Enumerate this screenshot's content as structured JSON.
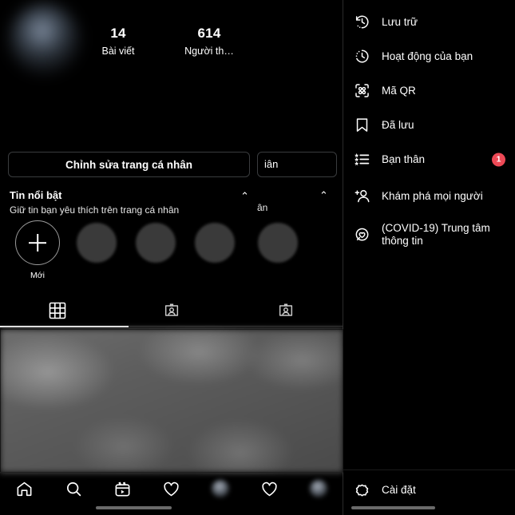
{
  "profile": {
    "stats": [
      {
        "number": "14",
        "label": "Bài viết"
      },
      {
        "number": "614",
        "label": "Người th…"
      }
    ],
    "edit_button_label": "Chỉnh sửa trang cá nhân",
    "highlights": {
      "title": "Tin nổi bật",
      "subtitle": "Giữ tin bạn yêu thích trên trang cá nhân",
      "new_label": "Mới",
      "collapse_chevron": "⌃"
    },
    "ghost_layer": {
      "button_fragment": "iân",
      "subtitle_fragment": "ân",
      "chevron": "⌃"
    },
    "tabs": [
      {
        "name": "grid-tab",
        "icon": "grid-icon",
        "active": true
      },
      {
        "name": "tagged-tab",
        "icon": "portrait-icon",
        "active": false
      },
      {
        "name": "tagged-tab-2",
        "icon": "portrait-icon",
        "active": false
      }
    ],
    "bottom_nav": [
      {
        "name": "home",
        "icon": "home-icon"
      },
      {
        "name": "search",
        "icon": "search-icon"
      },
      {
        "name": "reels",
        "icon": "reels-icon"
      },
      {
        "name": "activity",
        "icon": "heart-icon"
      },
      {
        "name": "profile",
        "icon": "avatar-icon"
      },
      {
        "name": "activity-2",
        "icon": "heart-icon"
      },
      {
        "name": "profile-2",
        "icon": "avatar-icon"
      }
    ]
  },
  "menu": {
    "items": [
      {
        "label": "Lưu trữ",
        "icon": "archive-clock-icon",
        "badge": ""
      },
      {
        "label": "Hoạt động của bạn",
        "icon": "activity-clock-icon",
        "badge": ""
      },
      {
        "label": "Mã QR",
        "icon": "qr-code-icon",
        "badge": ""
      },
      {
        "label": "Đã lưu",
        "icon": "bookmark-icon",
        "badge": ""
      },
      {
        "label": "Bạn thân",
        "icon": "star-list-icon",
        "badge": "1"
      },
      {
        "label": "Khám phá mọi người",
        "icon": "add-person-icon",
        "badge": ""
      },
      {
        "label": "(COVID-19) Trung tâm thông tin",
        "icon": "heart-circle-icon",
        "badge": ""
      }
    ],
    "settings": {
      "label": "Cài đặt",
      "icon": "gear-icon"
    }
  },
  "colors": {
    "background": "#000000",
    "text": "#ffffff",
    "badge": "#ed4956",
    "border": "#3a3c3e"
  }
}
